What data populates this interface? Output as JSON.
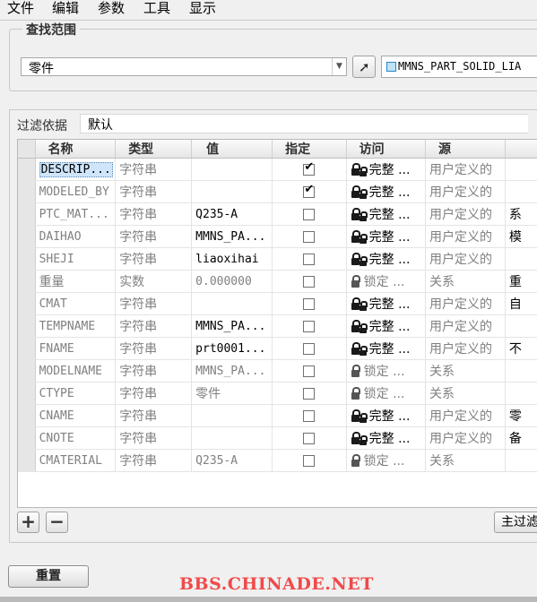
{
  "menu": [
    "文件",
    "编辑",
    "参数",
    "工具",
    "显示"
  ],
  "search_scope": {
    "legend": "查找范围",
    "scope_value": "零件",
    "model_name": "MMNS_PART_SOLID_LIA"
  },
  "filter": {
    "label": "过滤依据",
    "value": "默认"
  },
  "table": {
    "columns": [
      "名称",
      "类型",
      "值",
      "指定",
      "访问",
      "源"
    ],
    "rows": [
      {
        "name": "DESCRIP...",
        "type": "字符串",
        "value": "",
        "designated": true,
        "access": "完整 ...",
        "access_kind": "full",
        "source": "用户定义的",
        "extra": ""
      },
      {
        "name": "MODELED_BY",
        "type": "字符串",
        "value": "",
        "designated": true,
        "access": "完整 ...",
        "access_kind": "full",
        "source": "用户定义的",
        "extra": ""
      },
      {
        "name": "PTC_MAT...",
        "type": "字符串",
        "value": "Q235-A",
        "designated": false,
        "access": "完整 ...",
        "access_kind": "full",
        "source": "用户定义的",
        "extra": "系"
      },
      {
        "name": "DAIHAO",
        "type": "字符串",
        "value": "MMNS_PA...",
        "designated": false,
        "access": "完整 ...",
        "access_kind": "full",
        "source": "用户定义的",
        "extra": "模"
      },
      {
        "name": "SHEJI",
        "type": "字符串",
        "value": "liaoxihai",
        "designated": false,
        "access": "完整 ...",
        "access_kind": "full",
        "source": "用户定义的",
        "extra": ""
      },
      {
        "name": "重量",
        "type": "实数",
        "value": "0.000000",
        "designated": false,
        "access": "锁定 ...",
        "access_kind": "locked",
        "source": "关系",
        "extra": "重"
      },
      {
        "name": "CMAT",
        "type": "字符串",
        "value": "",
        "designated": false,
        "access": "完整 ...",
        "access_kind": "full",
        "source": "用户定义的",
        "extra": "自"
      },
      {
        "name": "TEMPNAME",
        "type": "字符串",
        "value": "MMNS_PA...",
        "designated": false,
        "access": "完整 ...",
        "access_kind": "full",
        "source": "用户定义的",
        "extra": ""
      },
      {
        "name": "FNAME",
        "type": "字符串",
        "value": "prt0001...",
        "designated": false,
        "access": "完整 ...",
        "access_kind": "full",
        "source": "用户定义的",
        "extra": "不"
      },
      {
        "name": "MODELNAME",
        "type": "字符串",
        "value": "MMNS_PA...",
        "designated": false,
        "access": "锁定 ...",
        "access_kind": "locked",
        "source": "关系",
        "extra": ""
      },
      {
        "name": "CTYPE",
        "type": "字符串",
        "value": "零件",
        "designated": false,
        "access": "锁定 ...",
        "access_kind": "locked",
        "source": "关系",
        "extra": ""
      },
      {
        "name": "CNAME",
        "type": "字符串",
        "value": "",
        "designated": false,
        "access": "完整 ...",
        "access_kind": "full",
        "source": "用户定义的",
        "extra": "零"
      },
      {
        "name": "CNOTE",
        "type": "字符串",
        "value": "",
        "designated": false,
        "access": "完整 ...",
        "access_kind": "full",
        "source": "用户定义的",
        "extra": "备"
      },
      {
        "name": "CMATERIAL",
        "type": "字符串",
        "value": "Q235-A",
        "designated": false,
        "access": "锁定 ...",
        "access_kind": "locked",
        "source": "关系",
        "extra": ""
      }
    ]
  },
  "buttons": {
    "add": "+",
    "remove": "−",
    "main_filter": "主过滤器",
    "reset": "重置"
  },
  "watermark": "BBS.CHINADE.NET",
  "colors": {
    "selection": "#cfe6fa",
    "watermark": "#f04a4a"
  }
}
